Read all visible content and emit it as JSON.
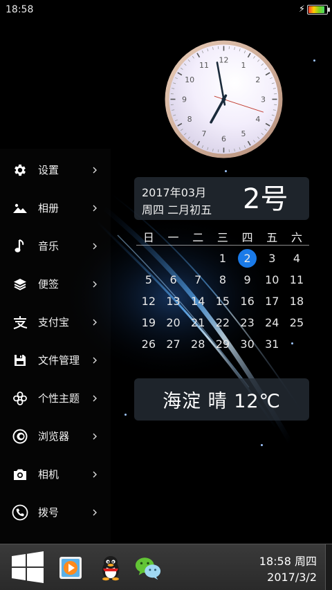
{
  "status_bar": {
    "time": "18:58",
    "battery_level": 0.9
  },
  "menu": [
    {
      "label": "设置",
      "icon": "gear-icon"
    },
    {
      "label": "相册",
      "icon": "landscape-icon"
    },
    {
      "label": "音乐",
      "icon": "music-note-icon"
    },
    {
      "label": "便签",
      "icon": "layers-icon"
    },
    {
      "label": "支付宝",
      "icon": "alipay-icon"
    },
    {
      "label": "文件管理",
      "icon": "floppy-icon"
    },
    {
      "label": "个性主题",
      "icon": "clover-icon"
    },
    {
      "label": "浏览器",
      "icon": "browser-icon"
    },
    {
      "label": "相机",
      "icon": "camera-icon"
    },
    {
      "label": "拨号",
      "icon": "phone-icon"
    }
  ],
  "clock": {
    "hour": 18,
    "minute": 58,
    "second": 18,
    "numerals": [
      "12",
      "1",
      "2",
      "3",
      "4",
      "5",
      "6",
      "7",
      "8",
      "9",
      "10",
      "11"
    ]
  },
  "date_card": {
    "year_month": "2017年03月",
    "weekday_lunar": "周四 二月初五",
    "day": "2号"
  },
  "calendar": {
    "weekdays": [
      "日",
      "一",
      "二",
      "三",
      "四",
      "五",
      "六"
    ],
    "weeks": [
      [
        "",
        "",
        "",
        "1",
        "2",
        "3",
        "4"
      ],
      [
        "5",
        "6",
        "7",
        "8",
        "9",
        "10",
        "11"
      ],
      [
        "12",
        "13",
        "14",
        "15",
        "16",
        "17",
        "18"
      ],
      [
        "19",
        "20",
        "21",
        "22",
        "23",
        "24",
        "25"
      ],
      [
        "26",
        "27",
        "28",
        "29",
        "30",
        "31",
        ""
      ]
    ],
    "today": "2"
  },
  "weather": {
    "text": "海淀 晴 12℃"
  },
  "taskbar": {
    "time_weekday": "18:58 周四",
    "date": "2017/3/2",
    "apps": [
      "video-player-icon",
      "qq-penguin-icon",
      "wechat-icon"
    ]
  },
  "colors": {
    "accent": "#1a7ae8",
    "card_bg": "#28303a",
    "taskbar_bg": "#333333"
  }
}
